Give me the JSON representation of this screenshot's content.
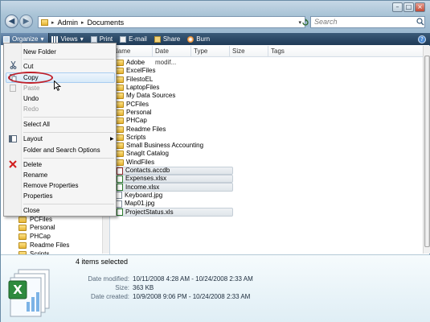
{
  "window": {
    "title_buttons": [
      "minimize-icon",
      "maximize-icon",
      "close-icon"
    ]
  },
  "address": {
    "crumbs": [
      "Admin",
      "Documents"
    ]
  },
  "search": {
    "placeholder": "Search"
  },
  "toolbar": {
    "organize": "Organize",
    "views": "Views",
    "print": "Print",
    "email": "E-mail",
    "share": "Share",
    "burn": "Burn",
    "help_icon": "help-icon"
  },
  "columns": {
    "name": "Name",
    "date_modified": "Date modif...",
    "type": "Type",
    "size": "Size",
    "tags": "Tags"
  },
  "files": [
    {
      "name": "Adobe",
      "kind": "folder",
      "selected": false
    },
    {
      "name": "ExcelFiles",
      "kind": "folder",
      "selected": false
    },
    {
      "name": "FilestoEL",
      "kind": "folder",
      "selected": false
    },
    {
      "name": "LaptopFiles",
      "kind": "folder",
      "selected": false
    },
    {
      "name": "My Data Sources",
      "kind": "folder",
      "selected": false
    },
    {
      "name": "PCFiles",
      "kind": "folder",
      "selected": false
    },
    {
      "name": "Personal",
      "kind": "folder",
      "selected": false
    },
    {
      "name": "PHCap",
      "kind": "folder",
      "selected": false
    },
    {
      "name": "Readme Files",
      "kind": "folder",
      "selected": false
    },
    {
      "name": "Scripts",
      "kind": "folder",
      "selected": false
    },
    {
      "name": "Small Business Accounting",
      "kind": "folder",
      "selected": false
    },
    {
      "name": "SnagIt Catalog",
      "kind": "folder",
      "selected": false
    },
    {
      "name": "WindFiles",
      "kind": "folder",
      "selected": false
    },
    {
      "name": "Contacts.accdb",
      "kind": "file",
      "selected": true
    },
    {
      "name": "Expenses.xlsx",
      "kind": "file",
      "selected": true
    },
    {
      "name": "Income.xlsx",
      "kind": "file",
      "selected": true
    },
    {
      "name": "Keyboard.jpg",
      "kind": "file",
      "selected": false
    },
    {
      "name": "Map01.jpg",
      "kind": "file",
      "selected": false
    },
    {
      "name": "ProjectStatus.xls",
      "kind": "file",
      "selected": true
    }
  ],
  "nav_items": [
    "PCFiles",
    "Personal",
    "PHCap",
    "Readme Files",
    "Scripts"
  ],
  "menu": {
    "new_folder": "New Folder",
    "cut": "Cut",
    "copy": "Copy",
    "paste": "Paste",
    "undo": "Undo",
    "redo": "Redo",
    "select_all": "Select All",
    "layout": "Layout",
    "folder_options": "Folder and Search Options",
    "delete": "Delete",
    "rename": "Rename",
    "remove_properties": "Remove Properties",
    "properties": "Properties",
    "close": "Close"
  },
  "details": {
    "summary": "4 items selected",
    "date_modified_label": "Date modified:",
    "date_modified_value": "10/11/2008 4:28 AM - 10/24/2008 2:33 AM",
    "size_label": "Size:",
    "size_value": "363 KB",
    "date_created_label": "Date created:",
    "date_created_value": "10/9/2008 9:06 PM - 10/24/2008 2:33 AM"
  },
  "colors": {
    "toolbar": "#1f3b57",
    "highlight_ring": "#c0202a",
    "selection": "#dfe5ea"
  }
}
